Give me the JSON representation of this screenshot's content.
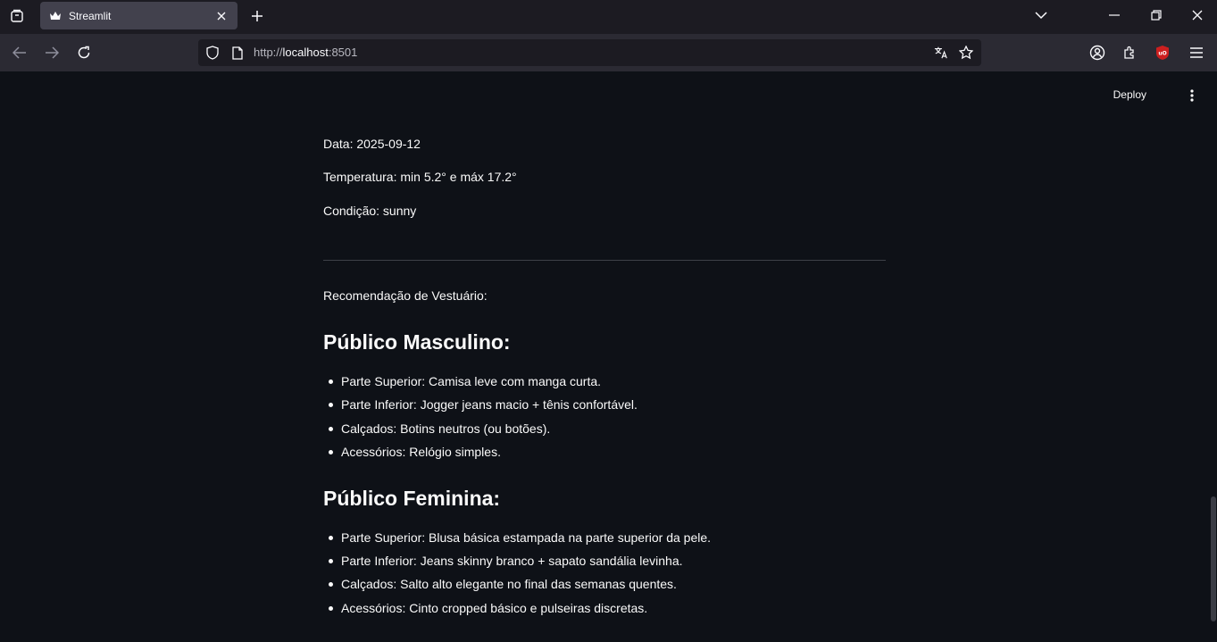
{
  "browser": {
    "tab_title": "Streamlit",
    "url_prefix": "http://",
    "url_host": "localhost",
    "url_suffix": ":8501",
    "accent": "#42414d"
  },
  "app": {
    "deploy_label": "Deploy",
    "info_lines": [
      "Data: 2025-09-12",
      "Temperatura: min 5.2° e máx 17.2°",
      "Condição: sunny"
    ],
    "recommendation_label": "Recomendação de Vestuário:",
    "sections": [
      {
        "heading": "Público Masculino:",
        "items": [
          "Parte Superior: Camisa leve com manga curta.",
          "Parte Inferior: Jogger jeans macio + tênis confortável.",
          "Calçados: Botins neutros (ou botões).",
          "Acessórios: Relógio simples."
        ]
      },
      {
        "heading": "Público Feminina:",
        "items": [
          "Parte Superior: Blusa básica estampada na parte superior da pele.",
          "Parte Inferior: Jeans skinny branco + sapato sandália levinha.",
          "Calçados: Salto alto elegante no final das semanas quentes.",
          "Acessórios: Cinto cropped básico e pulseiras discretas."
        ]
      }
    ]
  }
}
